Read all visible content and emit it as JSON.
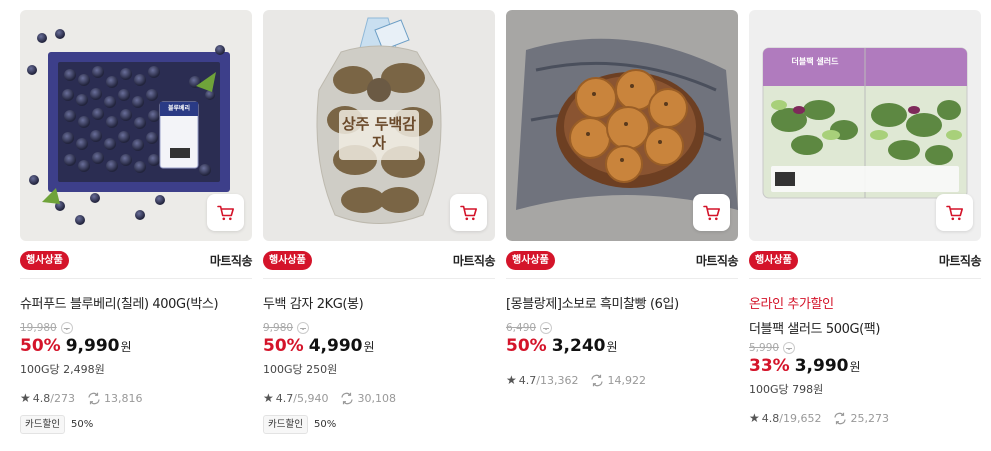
{
  "cart_label": "장바구니 담기",
  "products": [
    {
      "badge": "행사상품",
      "shipping": "마트직송",
      "promo": "",
      "title": "슈퍼푸드 블루베리(칠레) 400G(박스)",
      "original_price": "19,980",
      "discount_rate": "50%",
      "price": "9,990",
      "won": "원",
      "unit_price": "100G당 2,498원",
      "rating": "4.8",
      "review_count": "/273",
      "reorder_count": "13,816",
      "card_tag": "카드할인",
      "card_pct": "50%",
      "image_text": "블루베리"
    },
    {
      "badge": "행사상품",
      "shipping": "마트직송",
      "promo": "",
      "title": "두백 감자 2KG(봉)",
      "original_price": "9,980",
      "discount_rate": "50%",
      "price": "4,990",
      "won": "원",
      "unit_price": "100G당 250원",
      "rating": "4.7",
      "review_count": "/5,940",
      "reorder_count": "30,108",
      "card_tag": "카드할인",
      "card_pct": "50%",
      "image_text": "상주 두백감자"
    },
    {
      "badge": "행사상품",
      "shipping": "마트직송",
      "promo": "",
      "title": "[몽블랑제]소보로 흑미찰빵 (6입)",
      "original_price": "6,490",
      "discount_rate": "50%",
      "price": "3,240",
      "won": "원",
      "unit_price": "",
      "rating": "4.7",
      "review_count": "/13,362",
      "reorder_count": "14,922",
      "card_tag": "",
      "card_pct": "",
      "image_text": ""
    },
    {
      "badge": "행사상품",
      "shipping": "마트직송",
      "promo": "온라인 추가할인",
      "title": "더블팩 샐러드 500G(팩)",
      "original_price": "5,990",
      "discount_rate": "33%",
      "price": "3,990",
      "won": "원",
      "unit_price": "100G당 798원",
      "rating": "4.8",
      "review_count": "/19,652",
      "reorder_count": "25,273",
      "card_tag": "",
      "card_pct": "",
      "image_text": "더블팩 샐러드"
    }
  ]
}
